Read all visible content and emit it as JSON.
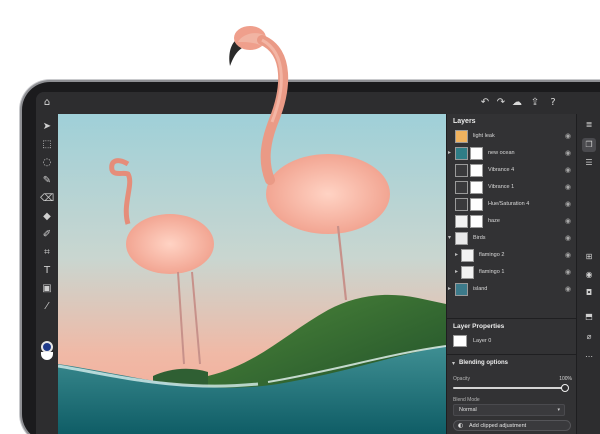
{
  "layers_panel": {
    "title": "Layers",
    "layers": [
      {
        "name": "light leak",
        "chevron": ""
      },
      {
        "name": "new ocean",
        "chevron": "▸"
      },
      {
        "name": "Vibrance 4",
        "chevron": ""
      },
      {
        "name": "Vibrance 1",
        "chevron": ""
      },
      {
        "name": "Hue/Saturation 4",
        "chevron": ""
      },
      {
        "name": "haze",
        "chevron": ""
      },
      {
        "name": "Birds",
        "chevron": "▾"
      },
      {
        "name": "flamingo 2",
        "chevron": "▸"
      },
      {
        "name": "flamingo 1",
        "chevron": "▸"
      },
      {
        "name": "island",
        "chevron": "▸"
      }
    ]
  },
  "layer_properties": {
    "title": "Layer Properties",
    "layer_name": "Layer 0"
  },
  "blending": {
    "title": "Blending options",
    "opacity_label": "Opacity",
    "opacity_value": "100%",
    "opacity_fraction": 1.0,
    "blend_mode_label": "Blend Mode",
    "blend_mode_value": "Normal"
  },
  "clip_button": {
    "label": "Add clipped adjustment"
  },
  "colors": {
    "foreground": "#1f3a8a",
    "background": "#ffffff",
    "panel": "#323234",
    "chrome": "#2d2d2f"
  },
  "icons": {
    "top_left": [
      "home-icon"
    ],
    "top_right": [
      "undo-icon",
      "redo-icon",
      "cloud-icon",
      "share-icon",
      "help-icon"
    ],
    "tools": [
      "move-icon",
      "select-icon",
      "lasso-icon",
      "brush-icon",
      "eraser-icon",
      "fill-icon",
      "clone-icon",
      "crop-icon",
      "type-icon",
      "image-icon",
      "eyedropper-icon"
    ],
    "rail": [
      "layers-icon",
      "layer-stack-icon",
      "adjust-icon",
      "add-layer-icon",
      "visibility-icon",
      "mask-icon",
      "group-icon",
      "clear-icon",
      "more-icon"
    ]
  }
}
